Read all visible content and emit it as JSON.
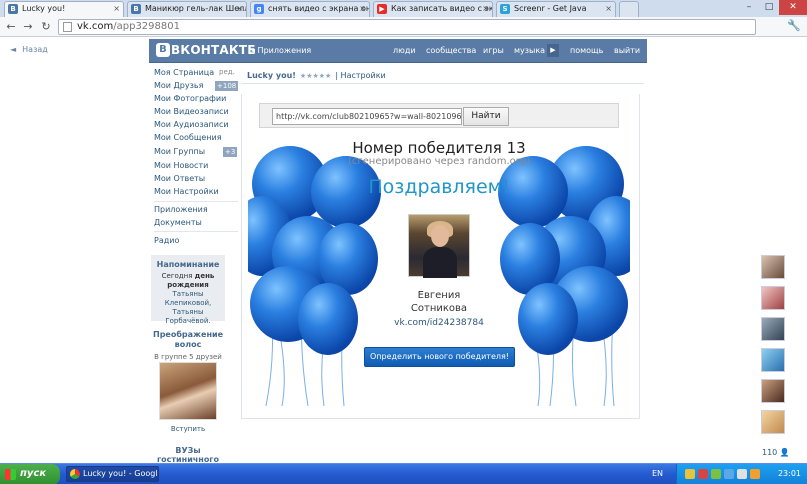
{
  "tabs": [
    {
      "label": "Lucky you!",
      "icon": "vk-icon",
      "color": "#4a76a8",
      "active": true
    },
    {
      "label": "Маникюр гель-лак Шеллак",
      "icon": "vk-icon",
      "color": "#4a76a8",
      "active": false
    },
    {
      "label": "снять видео с экрана онлайн",
      "icon": "google-icon",
      "color": "#4285f4",
      "active": false
    },
    {
      "label": "Как записать видео с экрана",
      "icon": "youtube-icon",
      "color": "#e52d27",
      "active": false
    },
    {
      "label": "Screenr - Get Java",
      "icon": "screenr-icon",
      "color": "#2aa4d5",
      "active": false
    }
  ],
  "window_controls": {
    "minimize": "–",
    "maximize": "□",
    "close": "✕"
  },
  "nav": {
    "back": "←",
    "forward": "→",
    "reload": "↻",
    "url_host": "vk.com",
    "url_path": "/app3298801",
    "wrench": "🔧"
  },
  "back_link": {
    "arrow": "◄",
    "label": "Назад"
  },
  "vk": {
    "logo_letter": "В",
    "logo": "ВКОНТАКТЕ",
    "apps_link": "◂ Приложения",
    "menu": [
      "люди",
      "сообщества",
      "игры",
      "музыка",
      "помощь",
      "выйти"
    ],
    "play": "▶"
  },
  "sidebar": {
    "edit": "ред.",
    "items": [
      {
        "label": "Моя Страница",
        "badge": ""
      },
      {
        "label": "Мои Друзья",
        "badge": "+108"
      },
      {
        "label": "Мои Фотографии",
        "badge": ""
      },
      {
        "label": "Мои Видеозаписи",
        "badge": ""
      },
      {
        "label": "Мои Аудиозаписи",
        "badge": ""
      },
      {
        "label": "Мои Сообщения",
        "badge": ""
      },
      {
        "label": "Мои Группы",
        "badge": "+3"
      },
      {
        "label": "Мои Новости",
        "badge": ""
      },
      {
        "label": "Мои Ответы",
        "badge": ""
      },
      {
        "label": "Мои Настройки",
        "badge": ""
      }
    ],
    "extra": [
      "Приложения",
      "Документы",
      "Радио"
    ],
    "reminder": {
      "title": "Напоминание",
      "line1": "Сегодня",
      "line1b": "день",
      "line2": "рождения",
      "line2b": "Татьяны",
      "line3": "Клепиковой,",
      "line4": "Татьяны",
      "line5": "Горбачёвой."
    },
    "ad": {
      "title1": "Преображение",
      "title2": "волос",
      "subtitle": "В группе 5 друзей",
      "join": "Вступить"
    },
    "ad2": {
      "line1": "ВУЗы",
      "line2": "гостиничного"
    }
  },
  "app": {
    "title": "Lucky you!",
    "stars": "★★★★★",
    "settings": "| Настройки",
    "search_value": "http://vk.com/club80210965?w=wall-80210965",
    "find_button": "Найти",
    "winner_number": "Номер победителя 13",
    "generated": "(сгенерировано через random.org)",
    "congrats": "Поздравляем!",
    "winner_first": "Евгения",
    "winner_last": "Сотникова",
    "winner_link": "vk.com/id24238784",
    "new_winner_button": "Определить нового победителя!"
  },
  "friends": {
    "count": "110",
    "icon": "person-icon"
  },
  "taskbar": {
    "start": "пуск",
    "task": "Lucky you! - Google ...",
    "lang": "EN",
    "time": "23:01"
  },
  "colors": {
    "vk_blue": "#597ba5",
    "link": "#2b587a",
    "accent": "#1f95c9",
    "balloon": "#1f6fd6"
  }
}
